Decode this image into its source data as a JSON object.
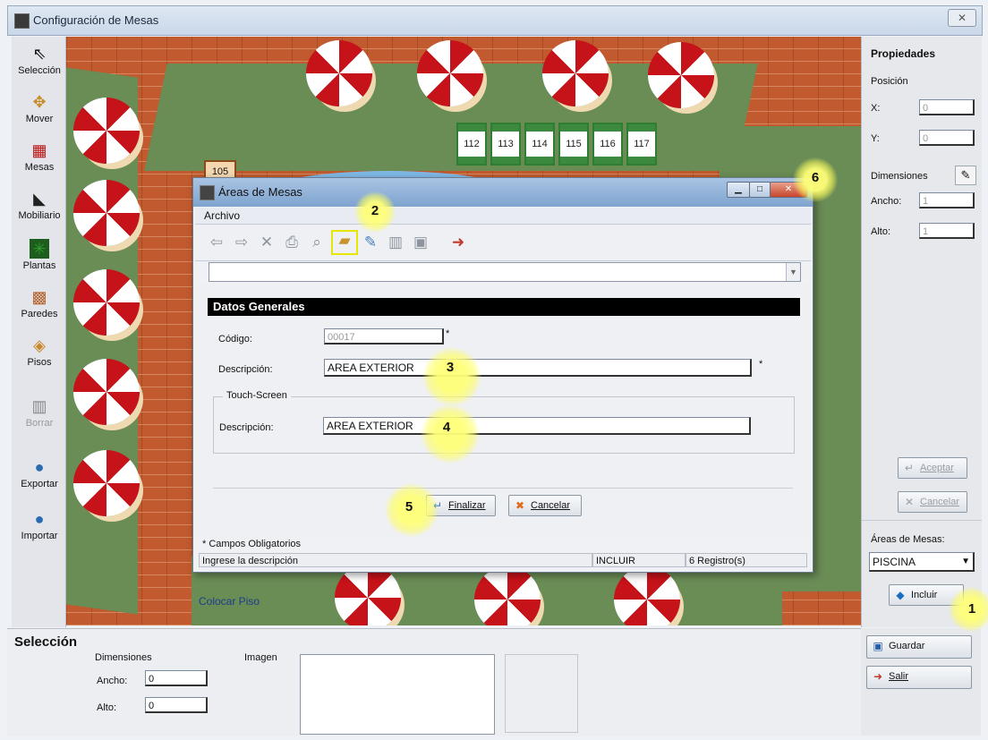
{
  "window": {
    "title": "Configuración de Mesas",
    "close": "✕"
  },
  "toolbar": {
    "items": [
      {
        "label": "Selección",
        "icon": "arrow-cursor-icon",
        "glyph": "⇖"
      },
      {
        "label": "Mover",
        "icon": "move-hand-icon",
        "glyph": "✥"
      },
      {
        "label": "Mesas",
        "icon": "table-icon",
        "glyph": "▦"
      },
      {
        "label": "Mobiliario",
        "icon": "furniture-icon",
        "glyph": "◣"
      },
      {
        "label": "Plantas",
        "icon": "plant-icon",
        "glyph": "✳"
      },
      {
        "label": "Paredes",
        "icon": "wall-icon",
        "glyph": "▩"
      },
      {
        "label": "Pisos",
        "icon": "floor-icon",
        "glyph": "◈"
      },
      {
        "label": "Borrar",
        "icon": "trash-icon",
        "glyph": "▥"
      },
      {
        "label": "Exportar",
        "icon": "export-globe-icon",
        "glyph": "●"
      },
      {
        "label": "Importar",
        "icon": "import-globe-icon",
        "glyph": "●"
      }
    ]
  },
  "canvas": {
    "tables": [
      "112",
      "113",
      "114",
      "115",
      "116",
      "117",
      "105"
    ],
    "floor_label": "Colocar Piso"
  },
  "properties": {
    "title": "Propiedades",
    "position": "Posición",
    "x_label": "X:",
    "x_value": "0",
    "y_label": "Y:",
    "y_value": "0",
    "dimensions": "Dimensiones",
    "width_label": "Ancho:",
    "width_value": "1",
    "height_label": "Alto:",
    "height_value": "1",
    "accept": "Aceptar",
    "cancel": "Cancelar",
    "areas_label": "Áreas de Mesas:",
    "areas_value": "PISCINA",
    "include": "Incluir"
  },
  "bottom": {
    "title": "Selección",
    "dimensions": "Dimensiones",
    "image": "Imagen",
    "width_label": "Ancho:",
    "width_value": "0",
    "height_label": "Alto:",
    "height_value": "0",
    "save": "Guardar",
    "exit": "Salir"
  },
  "dialog": {
    "title": "Áreas de Mesas",
    "menu_file": "Archivo",
    "section": "Datos Generales",
    "code_label": "Código:",
    "code_value": "00017",
    "desc_label": "Descripción:",
    "desc_value": "AREA EXTERIOR",
    "touch_legend": "Touch-Screen",
    "touch_desc_label": "Descripción:",
    "touch_desc_value": "AREA EXTERIOR",
    "finish": "Finalizar",
    "cancel": "Cancelar",
    "required_note": "* Campos Obligatorios",
    "status_hint": "Ingrese la descripción",
    "status_mode": "INCLUIR",
    "status_count": "6 Registro(s)",
    "asterisk": "*"
  },
  "callouts": [
    "1",
    "2",
    "3",
    "4",
    "5",
    "6"
  ],
  "colors": {
    "accent_highlight": "#e6e600",
    "umbrella_red": "#c61219",
    "grass": "#6a8c55",
    "brick": "#c15a2e"
  }
}
